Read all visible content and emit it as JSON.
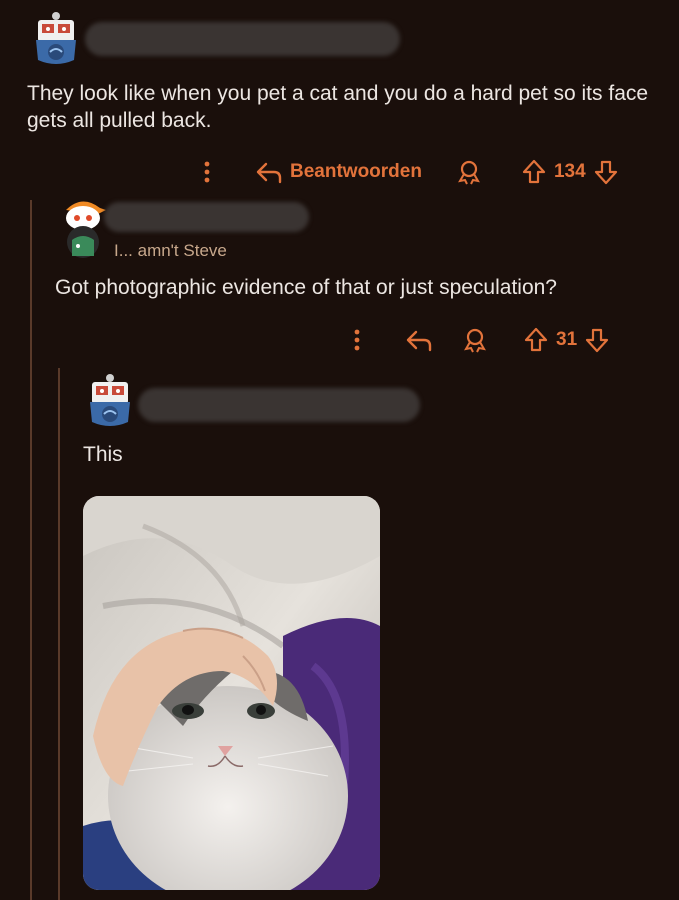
{
  "comments": [
    {
      "author": "",
      "body": "They look like when you pet a cat and you do a hard pet so its face gets all pulled back.",
      "actions": {
        "reply_label": "Beantwoorden",
        "votes": "134"
      }
    },
    {
      "author": "",
      "flair": "I... amn't Steve",
      "body": "Got photographic evidence of that or just speculation?",
      "actions": {
        "votes": "31"
      }
    },
    {
      "author": "",
      "body": "This",
      "image": {
        "subject": "cat being petted"
      }
    }
  ],
  "colors": {
    "accent": "#e2733b",
    "background": "#1a0f0b",
    "text": "#ece6e2"
  },
  "icons": [
    "more-icon",
    "reply-icon",
    "award-icon",
    "upvote-icon",
    "downvote-icon"
  ]
}
